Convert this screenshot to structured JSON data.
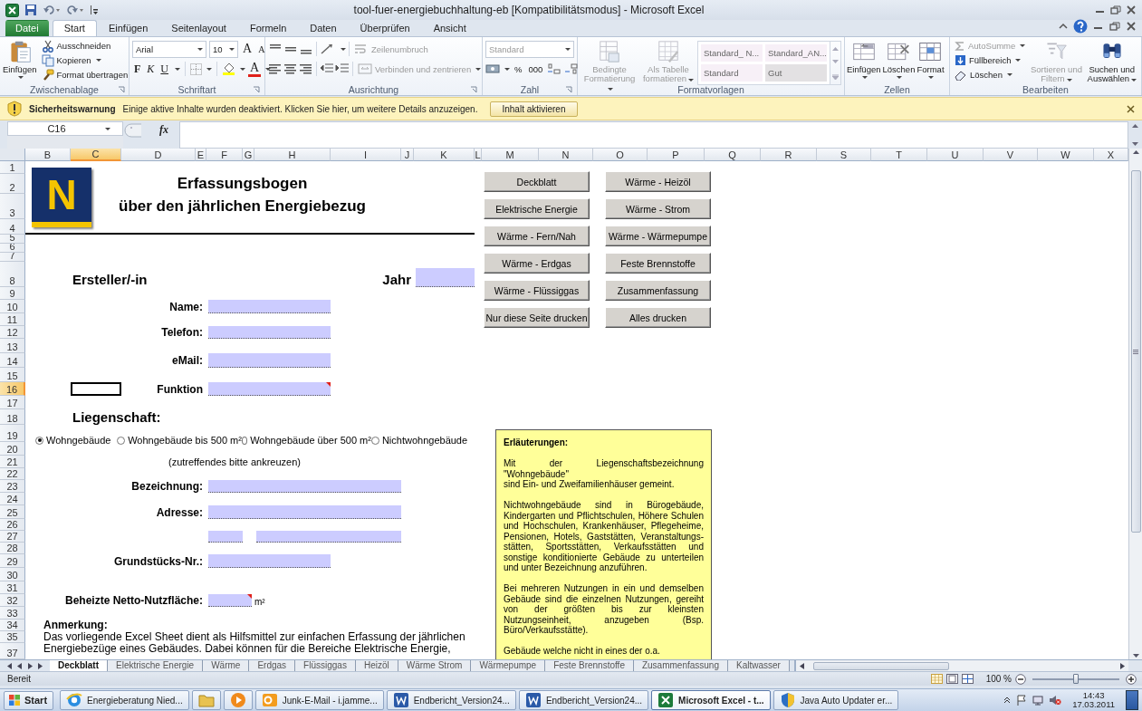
{
  "window": {
    "title": "tool-fuer-energiebuchhaltung-eb [Kompatibilitätsmodus] - Microsoft Excel"
  },
  "ribbon": {
    "tabs": [
      {
        "label": "Datei",
        "kind": "file",
        "selected": false
      },
      {
        "label": "Start",
        "kind": "tab",
        "selected": true
      },
      {
        "label": "Einfügen",
        "kind": "tab",
        "selected": false
      },
      {
        "label": "Seitenlayout",
        "kind": "tab",
        "selected": false
      },
      {
        "label": "Formeln",
        "kind": "tab",
        "selected": false
      },
      {
        "label": "Daten",
        "kind": "tab",
        "selected": false
      },
      {
        "label": "Überprüfen",
        "kind": "tab",
        "selected": false
      },
      {
        "label": "Ansicht",
        "kind": "tab",
        "selected": false
      }
    ],
    "clipboard": {
      "label": "Zwischenablage",
      "paste": "Einfügen",
      "cut": "Ausschneiden",
      "copy": "Kopieren",
      "format_painter": "Format übertragen"
    },
    "font": {
      "label": "Schriftart",
      "name": "Arial",
      "size": "10",
      "grow": "A",
      "shrink": "A",
      "bold": "F",
      "italic": "K",
      "underline": "U",
      "foreground": "A"
    },
    "alignment": {
      "label": "Ausrichtung",
      "wrap": {
        "label": "Zeilenumbruch",
        "disabled": true
      },
      "merge": {
        "label": "Verbinden und zentrieren",
        "disabled": true
      }
    },
    "number": {
      "label": "Zahl",
      "format": {
        "value": "Standard",
        "disabled": true
      },
      "percent": "%",
      "thousands": "000"
    },
    "styles": {
      "label": "Formatvorlagen",
      "conditional": {
        "label": "Bedingte Formatierung",
        "disabled": true
      },
      "as_table": {
        "label": "Als Tabelle formatieren",
        "disabled": true
      },
      "gallery": [
        {
          "label": "Standard_ N...",
          "kind": "custom"
        },
        {
          "label": "Standard_AN...",
          "kind": "custom"
        },
        {
          "label": "Standard",
          "kind": "custom"
        },
        {
          "label": "Gut",
          "kind": "good"
        }
      ]
    },
    "cells": {
      "label": "Zellen",
      "insert": "Einfügen",
      "delete": "Löschen",
      "format": "Format"
    },
    "editing": {
      "label": "Bearbeiten",
      "autosum": {
        "label": "AutoSumme",
        "disabled": true
      },
      "fill": {
        "label": "Füllbereich",
        "disabled": false
      },
      "clear": {
        "label": "Löschen",
        "disabled": false
      },
      "sort": {
        "label": "Sortieren und Filtern",
        "disabled": true
      },
      "find": {
        "label": "Suchen und Auswählen",
        "disabled": false
      }
    }
  },
  "security_bar": {
    "title": "Sicherheitswarnung",
    "message": "Einige aktive Inhalte wurden deaktiviert. Klicken Sie hier, um weitere Details anzuzeigen.",
    "button": "Inhalt aktivieren"
  },
  "formula_bar": {
    "name_box": "C16",
    "fx": "fx"
  },
  "columns": [
    {
      "label": "B",
      "selected": false
    },
    {
      "label": "C",
      "selected": true
    },
    {
      "label": "D",
      "selected": false
    },
    {
      "label": "E",
      "selected": false
    },
    {
      "label": "F",
      "selected": false
    },
    {
      "label": "G",
      "selected": false
    },
    {
      "label": "H",
      "selected": false
    },
    {
      "label": "I",
      "selected": false
    },
    {
      "label": "J",
      "selected": false
    },
    {
      "label": "K",
      "selected": false
    },
    {
      "label": "L",
      "selected": false
    },
    {
      "label": "M",
      "selected": false
    },
    {
      "label": "N",
      "selected": false
    },
    {
      "label": "O",
      "selected": false
    },
    {
      "label": "P",
      "selected": false
    },
    {
      "label": "Q",
      "selected": false
    },
    {
      "label": "R",
      "selected": false
    },
    {
      "label": "S",
      "selected": false
    },
    {
      "label": "T",
      "selected": false
    },
    {
      "label": "U",
      "selected": false
    },
    {
      "label": "V",
      "selected": false
    },
    {
      "label": "W",
      "selected": false
    },
    {
      "label": "X",
      "selected": false
    }
  ],
  "rows": [
    {
      "label": "1",
      "selected": false
    },
    {
      "label": "2",
      "selected": false
    },
    {
      "label": "3",
      "selected": false
    },
    {
      "label": "4",
      "selected": false
    },
    {
      "label": "5",
      "selected": false
    },
    {
      "label": "6",
      "selected": false
    },
    {
      "label": "7",
      "selected": false
    },
    {
      "label": "8",
      "selected": false
    },
    {
      "label": "9",
      "selected": false
    },
    {
      "label": "10",
      "selected": false
    },
    {
      "label": "11",
      "selected": false
    },
    {
      "label": "12",
      "selected": false
    },
    {
      "label": "13",
      "selected": false
    },
    {
      "label": "14",
      "selected": false
    },
    {
      "label": "15",
      "selected": false
    },
    {
      "label": "16",
      "selected": true
    },
    {
      "label": "17",
      "selected": false
    },
    {
      "label": "18",
      "selected": false
    },
    {
      "label": "19",
      "selected": false
    },
    {
      "label": "20",
      "selected": false
    },
    {
      "label": "21",
      "selected": false
    },
    {
      "label": "22",
      "selected": false
    },
    {
      "label": "23",
      "selected": false
    },
    {
      "label": "24",
      "selected": false
    },
    {
      "label": "25",
      "selected": false
    },
    {
      "label": "26",
      "selected": false
    },
    {
      "label": "27",
      "selected": false
    },
    {
      "label": "28",
      "selected": false
    },
    {
      "label": "29",
      "selected": false
    },
    {
      "label": "30",
      "selected": false
    },
    {
      "label": "31",
      "selected": false
    },
    {
      "label": "32",
      "selected": false
    },
    {
      "label": "33",
      "selected": false
    },
    {
      "label": "34",
      "selected": false
    },
    {
      "label": "35",
      "selected": false
    },
    {
      "label": "37",
      "selected": false
    }
  ],
  "sheet": {
    "logo": "N",
    "title_lines": [
      "Erfassungsbogen",
      "über den jährlichen Energiebezug"
    ],
    "author_heading": "Ersteller/-in",
    "year_label": "Jahr",
    "contact_fields": [
      {
        "label": "Name:",
        "comment": false
      },
      {
        "label": "Telefon:",
        "comment": false
      },
      {
        "label": "eMail:",
        "comment": false
      },
      {
        "label": "Funktion",
        "comment": true
      }
    ],
    "property_heading": "Liegenschaft:",
    "building_types": [
      {
        "label": "Wohngebäude",
        "selected": true
      },
      {
        "label": "Wohngebäude bis 500 m²",
        "selected": false
      },
      {
        "label": "Wohngebäude über 500 m²",
        "selected": false
      },
      {
        "label": "Nichtwohngebäude",
        "selected": false
      }
    ],
    "hint": "(zutreffendes bitte ankreuzen)",
    "property_fields": [
      {
        "kind": "wide",
        "label": "Bezeichnung:",
        "comment": false
      },
      {
        "kind": "wide",
        "label": "Adresse:",
        "comment": false
      },
      {
        "kind": "split",
        "comment": false
      },
      {
        "kind": "medium",
        "label": "Grundstücks-Nr.:",
        "comment": false
      },
      {
        "kind": "small",
        "label": "Beheizte Netto-Nutzfläche:",
        "comment": true,
        "unit": "m²"
      }
    ],
    "note_heading": "Anmerkung:",
    "note": "Das vorliegende Excel Sheet dient als Hilfsmittel zur einfachen Erfassung der jährlichen Energiebezüge eines Gebäudes. Dabei können für die Bereiche Elektrische Energie,",
    "nav_buttons": [
      "Deckblatt",
      "Wärme - Heizöl",
      "Elektrische Energie",
      "Wärme - Strom",
      "Wärme - Fern/Nah",
      "Wärme - Wärmepumpe",
      "Wärme - Erdgas",
      "Feste Brennstoffe",
      "Wärme - Flüssiggas",
      "Zusammenfassung",
      "Nur diese Seite drucken",
      "Alles drucken"
    ],
    "explanation": {
      "heading": "Erläuterungen:",
      "paragraphs": [
        {
          "lines": [
            "Mit der Liegenschaftsbezeichnung \"Wohngebäude\"",
            "sind Ein- und Zweifamilienhäuser gemeint."
          ]
        },
        {
          "lines": [
            "Nichtwohngebäude sind in Bürogebäude, Kindergarten und Pflichtschulen, Höhere Schulen und Hochschulen, Krankenhäuser, Pflegeheime, Pensionen, Hotels, Gaststätten, Veranstaltungs-stätten, Sportsstätten, Verkaufsstätten und sonstige konditionierte Gebäude zu unterteilen und unter Bezeichnung anzuführen."
          ]
        },
        {
          "lines": [
            "Bei mehreren Nutzungen in ein und demselben Gebäude sind die einzelnen Nutzungen, gereiht von der größten bis zur kleinsten Nutzungseinheit, anzugeben (Bsp. Büro/Verkaufsstätte)."
          ]
        },
        {
          "lines": [
            "Gebäude welche nicht in eines der o.a."
          ]
        }
      ]
    }
  },
  "sheet_tabs": [
    {
      "label": "Deckblatt",
      "selected": true
    },
    {
      "label": "Elektrische Energie",
      "selected": false
    },
    {
      "label": "Wärme",
      "selected": false
    },
    {
      "label": "Erdgas",
      "selected": false
    },
    {
      "label": "Flüssiggas",
      "selected": false
    },
    {
      "label": "Heizöl",
      "selected": false
    },
    {
      "label": "Wärme Strom",
      "selected": false
    },
    {
      "label": "Wärmepumpe",
      "selected": false
    },
    {
      "label": "Feste Brennstoffe",
      "selected": false
    },
    {
      "label": "Zusammenfassung",
      "selected": false
    },
    {
      "label": "Kaltwasser",
      "selected": false
    }
  ],
  "status_bar": {
    "ready": "Bereit",
    "zoom": "100 %",
    "zoom_slider": {
      "level": 0.5
    }
  },
  "taskbar": {
    "start": "Start",
    "items": [
      {
        "kind": "ie",
        "label": "Energieberatung Nied...",
        "selected": false
      },
      {
        "kind": "folder",
        "selected": false
      },
      {
        "kind": "media",
        "selected": false
      },
      {
        "kind": "outlook",
        "label": "Junk-E-Mail - i.jamme...",
        "selected": false
      },
      {
        "kind": "word",
        "label": "Endbericht_Version24...",
        "selected": false
      },
      {
        "kind": "word",
        "label": "Endbericht_Version24...",
        "selected": false
      },
      {
        "kind": "excel",
        "label": "Microsoft Excel - t...",
        "selected": true
      },
      {
        "kind": "shield",
        "label": "Java Auto Updater er...",
        "selected": false
      }
    ],
    "time": "14:43",
    "date": "17.03.2011"
  }
}
